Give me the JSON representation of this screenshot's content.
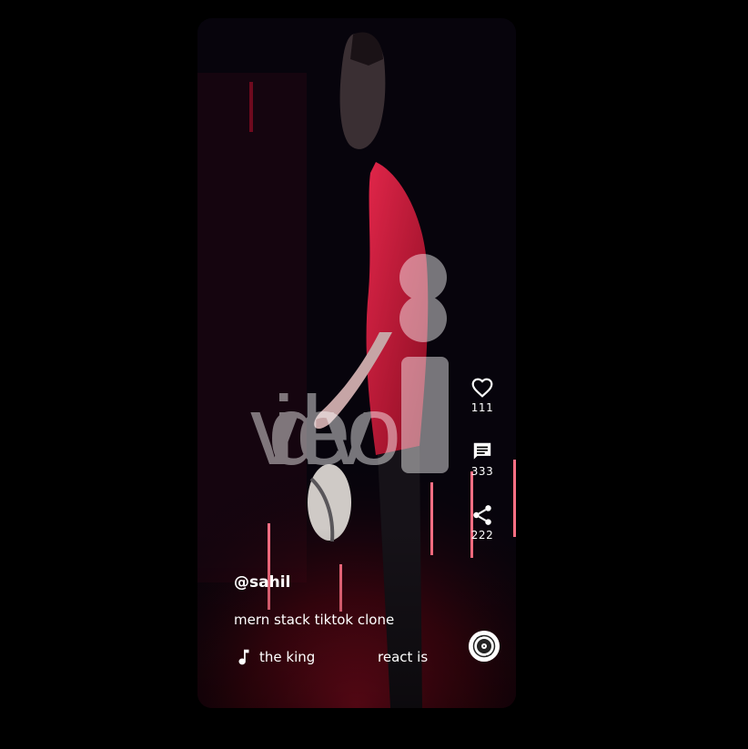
{
  "post": {
    "username": "@sahil",
    "description": "mern stack tiktok clone",
    "song_segments": [
      "the king",
      "react is"
    ]
  },
  "sidebar": {
    "likes": {
      "icon": "heart-outline-icon",
      "count": "111"
    },
    "messages": {
      "icon": "message-icon",
      "count": "333"
    },
    "shares": {
      "icon": "share-icon",
      "count": "222"
    }
  },
  "media": {
    "watermark": "videvo",
    "record_icon": "spinning-record-icon"
  },
  "colors": {
    "background": "#000000",
    "text": "#ffffff",
    "accent_red": "#d2193c"
  }
}
